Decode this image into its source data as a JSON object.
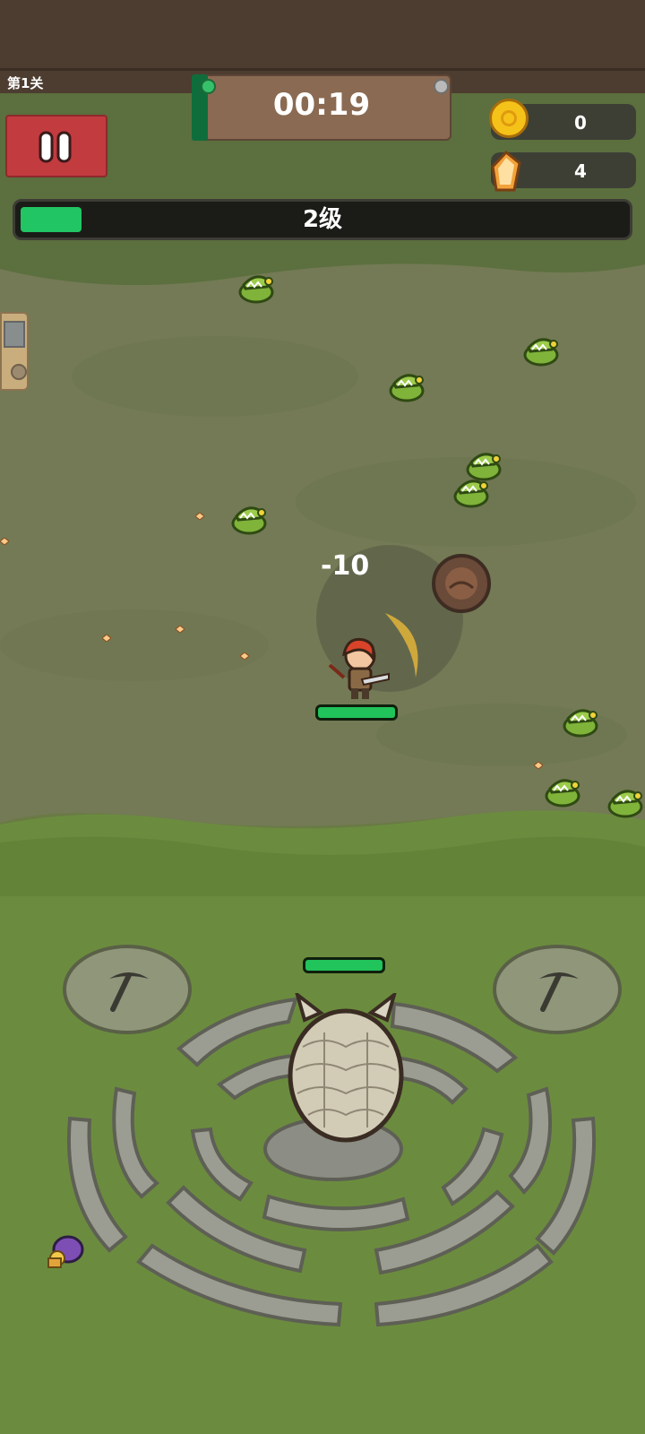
{
  "stage": {
    "label": "第1关"
  },
  "timer": {
    "text": "00:19"
  },
  "resources": {
    "coins": {
      "value": "0",
      "icon": "gold-coin-icon"
    },
    "gems": {
      "value": "4",
      "icon": "orange-gem-icon"
    }
  },
  "experience": {
    "level_label": "2级",
    "progress": 0.1
  },
  "player": {
    "hp_fraction": 1.0,
    "damage_text": "-10"
  },
  "egg": {
    "hp_fraction": 1.0
  },
  "pause": {
    "icon": "pause-icon"
  },
  "colors": {
    "health_green": "#21c35b",
    "pause_red": "#c23b3f",
    "board_brown": "#8a6a52",
    "enemy_green": "#7fb33a"
  }
}
